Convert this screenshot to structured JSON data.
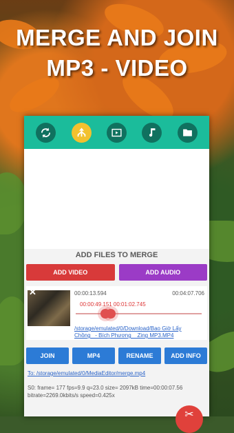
{
  "headline": {
    "line1": "MERGE AND JOIN",
    "line2": "MP3 - VIDEO"
  },
  "toolbar": {
    "buttons": [
      {
        "icon": "sync-icon"
      },
      {
        "icon": "merge-icon",
        "active": true
      },
      {
        "icon": "play-video-icon"
      },
      {
        "icon": "music-note-icon"
      },
      {
        "icon": "folder-icon"
      }
    ],
    "accent": "#1bbc9b"
  },
  "add_files": {
    "title": "ADD FILES TO MERGE",
    "add_video": "ADD VIDEO",
    "add_audio": "ADD AUDIO"
  },
  "item": {
    "close": "✕",
    "start_time": "00:00:13.594",
    "end_time": "00:04:07.706",
    "selection": "00:00:49.151 00:01:02.745",
    "path": "/storage/emulated/0/Download/Bao Giờ Lấy Chồng_ - Bích Phương _ Zing MP3.MP4"
  },
  "actions": {
    "join": "JOIN",
    "mp4": "MP4",
    "rename": "RENAME",
    "add_info": "ADD INFO"
  },
  "output": {
    "path": "To: /storage/emulated/0/MediaEditor/merge.mp4"
  },
  "log": {
    "line1": "S0: frame=  177 fps=9.9 q=23.0 size=    2097kB time=00:00:07.56",
    "line2": "bitrate=2269.0kbits/s speed=0.425x"
  },
  "fab": {
    "icon": "cut-icon",
    "glyph": "✂"
  }
}
